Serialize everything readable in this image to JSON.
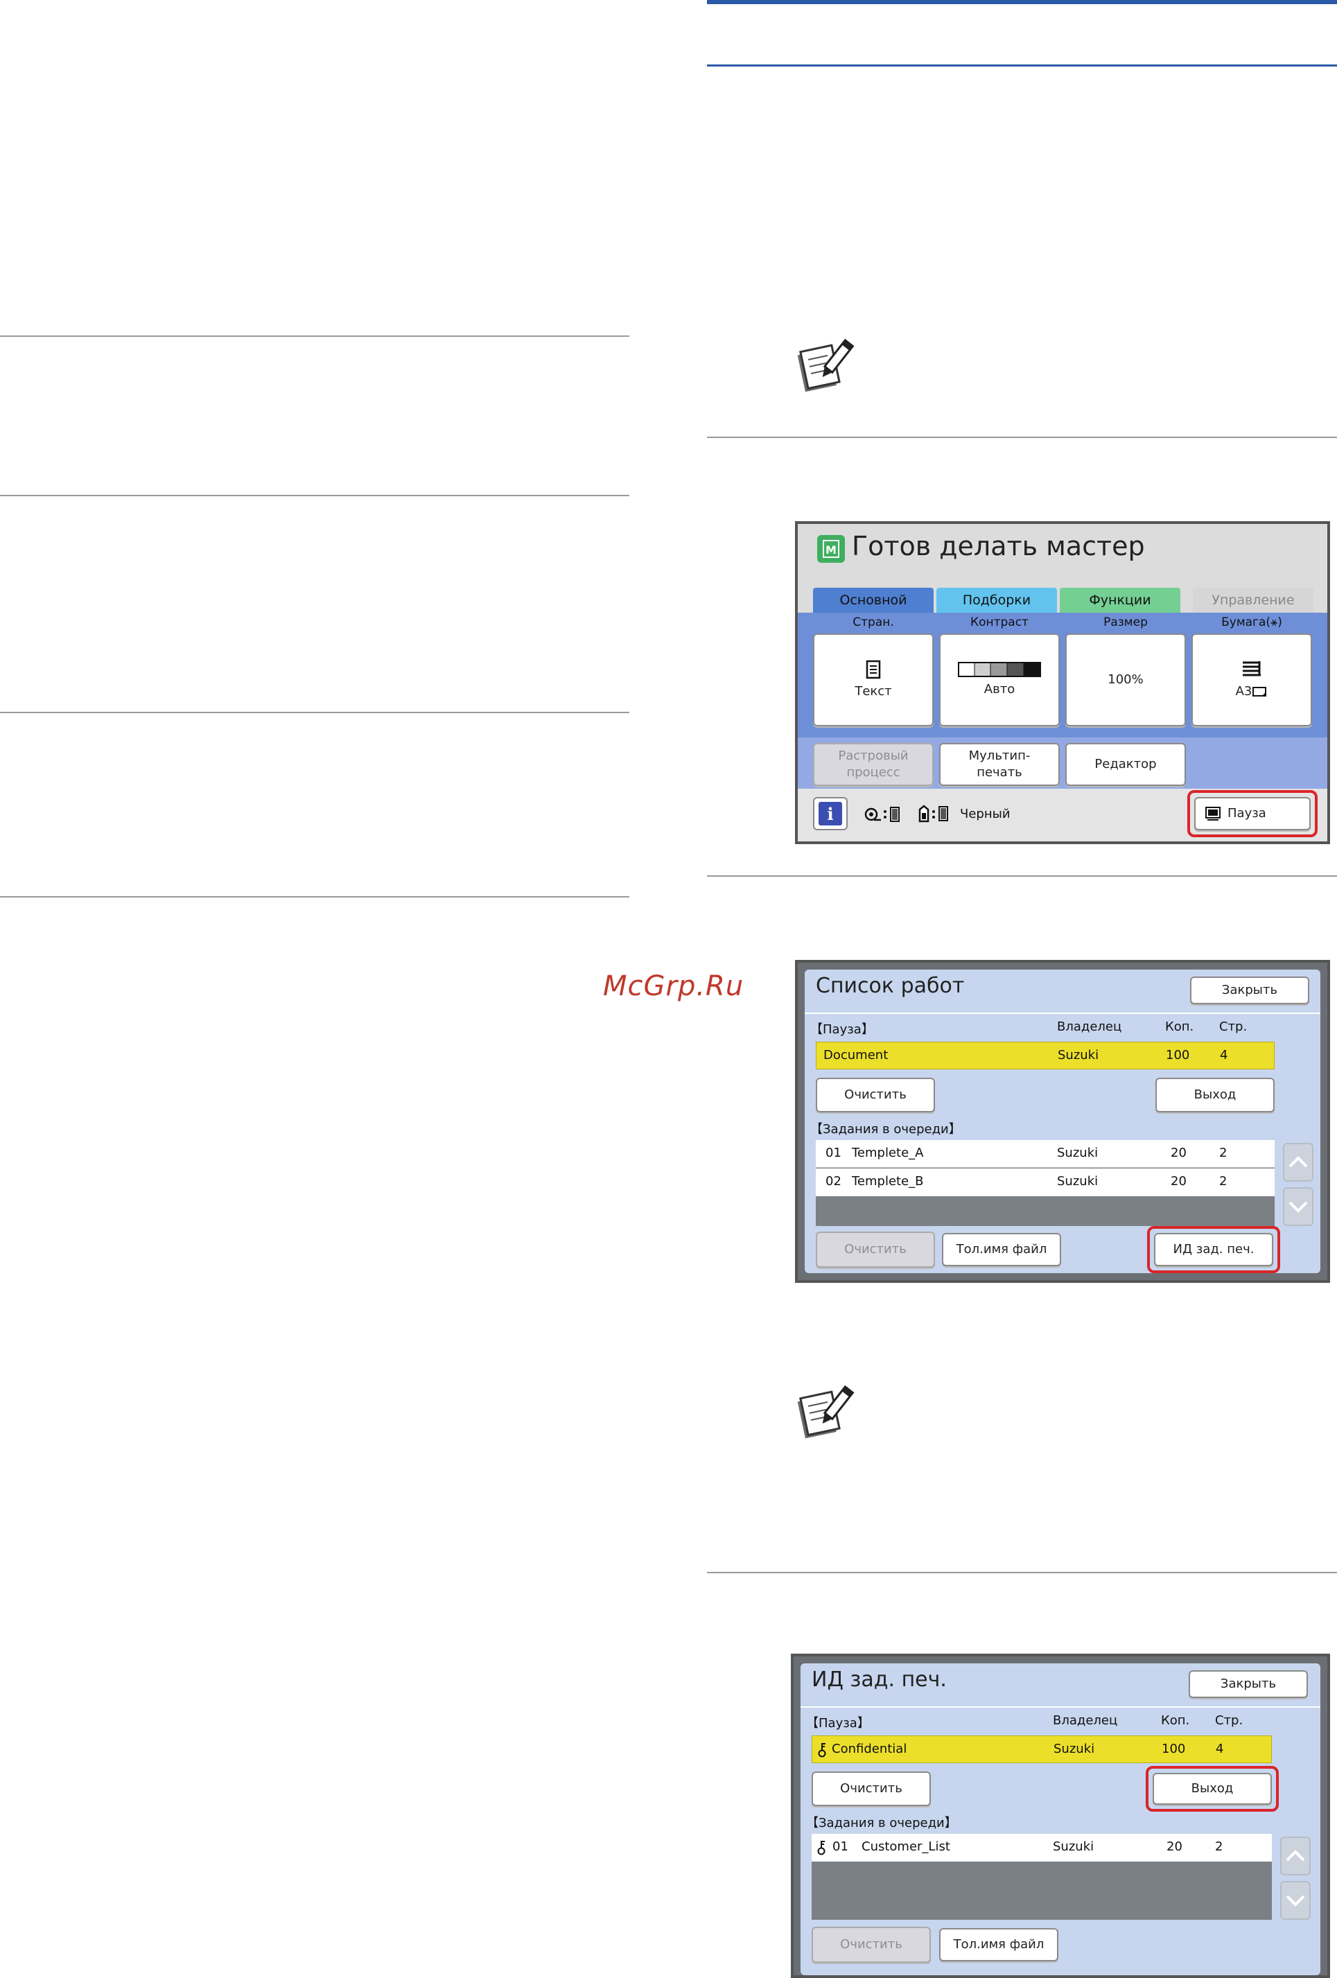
{
  "watermark": "McGrp.Ru",
  "screen1": {
    "title": "Готов делать мастер",
    "mode_icon_letter": "M",
    "tabs": [
      {
        "label": "Основной",
        "color": "#4f7fd0",
        "text": "#111"
      },
      {
        "label": "Подборки",
        "color": "#62c4ee",
        "text": "#111"
      },
      {
        "label": "Функции",
        "color": "#74cf93",
        "text": "#111"
      },
      {
        "label": "Управление",
        "color": "#d6d6d6",
        "text": "#888"
      }
    ],
    "col_labels": [
      "Стран.",
      "Контраст",
      "Размер",
      "Бумага"
    ],
    "paper_label_icon": "⚹",
    "tiles": [
      {
        "icon": "document-icon",
        "label": "Текст"
      },
      {
        "icon": "contrast-scale-icon",
        "label": "Авто"
      },
      {
        "icon": "",
        "label": "100%"
      },
      {
        "icon": "paper-stack-icon",
        "label": "A3"
      }
    ],
    "row2_buttons": [
      "Растровый процесс",
      "Мультип- печать",
      "Редактор"
    ],
    "info_icon": "i",
    "status_text": "Черный",
    "pause_button": "Пауза",
    "colors": {
      "frame": "#dcdcdc",
      "blue_band": "#6e8fd8",
      "light_band": "#92a9e3"
    }
  },
  "screen2": {
    "title": "Список работ",
    "close_button": "Закрыть",
    "paused_header": "【Пауза】",
    "columns": [
      "Владелец",
      "Коп.",
      "Стр."
    ],
    "paused_job": {
      "name": "Document",
      "owner": "Suzuki",
      "copies": "100",
      "pages": "4"
    },
    "clear_button": "Очистить",
    "exit_button": "Выход",
    "queue_header": "【Задания в очереди】",
    "queue": [
      {
        "no": "01",
        "name": "Templete_A",
        "owner": "Suzuki",
        "copies": "20",
        "pages": "2"
      },
      {
        "no": "02",
        "name": "Templete_B",
        "owner": "Suzuki",
        "copies": "20",
        "pages": "2"
      }
    ],
    "bottom_clear": "Очистить",
    "filename_button": "Тол.имя файл",
    "print_id_button": "ИД зад. печ.",
    "colors": {
      "bg": "#c7d6ee",
      "highlight": "#ecdf2a",
      "gray_row": "#7b8085"
    }
  },
  "screen3": {
    "title": "ИД зад. печ.",
    "close_button": "Закрыть",
    "paused_header": "【Пауза】",
    "columns": [
      "Владелец",
      "Коп.",
      "Стр."
    ],
    "paused_job": {
      "name": "Confidential",
      "owner": "Suzuki",
      "copies": "100",
      "pages": "4"
    },
    "clear_button": "Очистить",
    "exit_button": "Выход",
    "queue_header": "【Задания в очереди】",
    "queue": [
      {
        "no": "01",
        "name": "Customer_List",
        "owner": "Suzuki",
        "copies": "20",
        "pages": "2"
      }
    ],
    "bottom_clear": "Очистить",
    "filename_button": "Тол.имя файл"
  }
}
